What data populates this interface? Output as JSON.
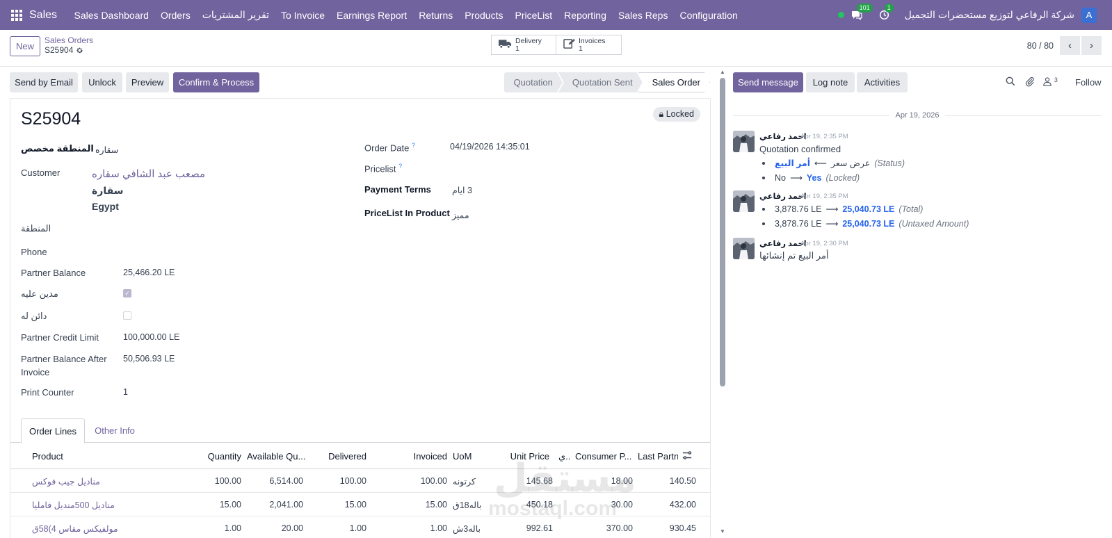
{
  "navbar": {
    "app_name": "Sales",
    "menu": [
      "Sales Dashboard",
      "Orders",
      "تقرير المشتريات",
      "To Invoice",
      "Earnings Report",
      "Returns",
      "Products",
      "PriceList",
      "Reporting",
      "Sales Reps",
      "Configuration"
    ],
    "messages_badge": "101",
    "activities_badge": "1",
    "company": "شركة الرفاعي لتوزيع مستحضرات التجميل",
    "avatar_letter": "A"
  },
  "control": {
    "new_label": "New",
    "breadcrumb_parent": "Sales Orders",
    "breadcrumb_current": "S25904",
    "smart_buttons": [
      {
        "label": "Delivery",
        "count": "1",
        "icon": "truck-icon"
      },
      {
        "label": "Invoices",
        "count": "1",
        "icon": "invoice-edit-icon"
      }
    ],
    "pager": "80 / 80"
  },
  "actions": {
    "send_email": "Send by Email",
    "unlock": "Unlock",
    "preview": "Preview",
    "confirm": "Confirm & Process",
    "stages": [
      "Quotation",
      "Quotation Sent",
      "Sales Order"
    ],
    "active_stage": "Sales Order"
  },
  "form": {
    "title": "S25904",
    "locked": "Locked",
    "fields": {
      "region_custom_label": "المنطقة مخصص",
      "region_custom_value": "سقاره",
      "customer_label": "Customer",
      "customer_name": "مصعب عبد الشافي سقاره",
      "customer_city": "سقارة",
      "customer_country": "Egypt",
      "region_label": "المنطقة",
      "phone_label": "Phone",
      "partner_balance_label": "Partner Balance",
      "partner_balance_value": "25,466.20 LE",
      "debtor_label": "مدين عليه",
      "debtor_checked": true,
      "creditor_label": "دائن له",
      "creditor_checked": false,
      "credit_limit_label": "Partner Credit Limit",
      "credit_limit_value": "100,000.00 LE",
      "balance_after_label_1": "Partner Balance After",
      "balance_after_label_2": "Invoice",
      "balance_after_value": "50,506.93 LE",
      "print_counter_label": "Print Counter",
      "print_counter_value": "1",
      "order_date_label": "Order Date",
      "order_date_value": "04/19/2026 14:35:01",
      "pricelist_label": "Pricelist",
      "payment_terms_label": "Payment Terms",
      "payment_terms_value": "3 ايام",
      "pricelist_product_label": "PriceList In Product",
      "pricelist_product_value": "مميز",
      "help_mark": "?"
    },
    "tabs": [
      "Order Lines",
      "Other Info"
    ],
    "table": {
      "headers": [
        "Product",
        "Quantity",
        "Available Qu...",
        "Delivered",
        "Invoiced",
        "UoM",
        "Unit Price",
        "ي..",
        "Consumer P...",
        "Last Partne"
      ],
      "rows": [
        {
          "product": "مناديل جيب فوكس",
          "qty": "100.00",
          "avail": "6,514.00",
          "delivered": "100.00",
          "invoiced": "100.00",
          "uom": "كرتونه",
          "unit_price": "145.68",
          "consumer": "18.00",
          "last": "140.50"
        },
        {
          "product": "مناديل 500منديل فامليا",
          "qty": "15.00",
          "avail": "2,041.00",
          "delivered": "15.00",
          "invoiced": "15.00",
          "uom": "باله18ق",
          "unit_price": "450.18",
          "consumer": "30.00",
          "last": "432.00"
        },
        {
          "product": "مولفيكس مقاس 4)58ق",
          "qty": "1.00",
          "avail": "20.00",
          "delivered": "1.00",
          "invoiced": "1.00",
          "uom": "باله3ش",
          "unit_price": "992.61",
          "consumer": "370.00",
          "last": "930.45"
        }
      ]
    }
  },
  "chatter": {
    "send_message": "Send message",
    "log_note": "Log note",
    "activities": "Activities",
    "followers_count": "3",
    "follow": "Follow",
    "date_separator": "Apr 19, 2026",
    "messages": [
      {
        "author": "احمد رفاعي",
        "date": "Apr 19, 2:35 PM",
        "body": "Quotation confirmed",
        "tracking": [
          {
            "old": "عرض سعر",
            "new": "أمر البيع",
            "field": "(Status)"
          },
          {
            "old": "No",
            "new": "Yes",
            "field": "(Locked)"
          }
        ]
      },
      {
        "author": "احمد رفاعي",
        "date": "Apr 19, 2:35 PM",
        "body": "",
        "tracking": [
          {
            "old": "3,878.76 LE",
            "new": "25,040.73 LE",
            "field": "(Total)"
          },
          {
            "old": "3,878.76 LE",
            "new": "25,040.73 LE",
            "field": "(Untaxed Amount)"
          }
        ]
      },
      {
        "author": "احمد رفاعي",
        "date": "Apr 19, 2:30 PM",
        "body": "أمر البيع تم إنشائها",
        "tracking": []
      }
    ]
  },
  "watermark": {
    "arabic": "مستقل",
    "latin": "mostaql.com"
  },
  "colors": {
    "brand": "#71639e",
    "link_blue": "#2563eb",
    "online": "#22c55e",
    "badge": "#22a14a"
  }
}
